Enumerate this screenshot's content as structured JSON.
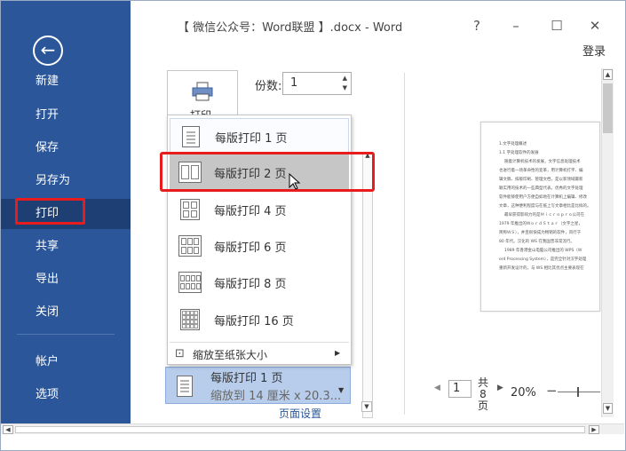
{
  "window": {
    "title": "【 微信公众号：Word联盟 】.docx - Word",
    "help": "?",
    "minimize": "–",
    "maximize": "☐",
    "close": "✕",
    "login": "登录"
  },
  "sidebar": {
    "back": "←",
    "items": [
      "新建",
      "打开",
      "保存",
      "另存为",
      "打印",
      "共享",
      "导出",
      "关闭",
      "帐户",
      "选项"
    ],
    "active": "打印"
  },
  "print": {
    "button_label": "打印",
    "copies_label": "份数:",
    "copies_value": "1",
    "spin_up": "▲",
    "spin_down": "▼"
  },
  "dropdown": {
    "items": [
      "每版打印 1 页",
      "每版打印 2 页",
      "每版打印 4 页",
      "每版打印 6 页",
      "每版打印 8 页",
      "每版打印 16 页"
    ],
    "selected_index": 1,
    "scale_label": "缩放至纸张大小",
    "submenu_arrow": "▶"
  },
  "pages_per_sheet": {
    "title": "每版打印 1 页",
    "subtitle": "缩放到 14 厘米 x 20.3...",
    "arrow": "▼"
  },
  "page_setup": "页面设置",
  "preview": {
    "lines": [
      "1.文字处理概述",
      "1.1 字处理软件的发展",
      "随着计算机技术的发展，文字信息处理技术",
      "也进行着一场革命性的变革，用计算机打字、编",
      "辑文稿、排版印刷、管理文档，是以新领域最新",
      "颖实用的技术的一些典型代表。优秀的文字处理",
      "软件能够使用户方便自如地在计算机上编辑、修改",
      "文章，这种便利程度与在纸上写文章相比是比拟的。",
      "最早获得影响力的是Ｍｉｃｒｏｐｒｏ公司在",
      "1979 年推出的ＷｏｒｄＳｔａｒ（文字之星，",
      "简称ＷＳ），并且很快成为畅销的软件，风行于",
      "80 年代。汉化的 WS 在我国曾非常流行。",
      "1989 年香港金山电脑公司推出的 WPS（Ｗ",
      "ord Processing System），是完全针对汉字处理",
      "重新开发设计的，与 WS 相比其优点主要表现在"
    ]
  },
  "navigation": {
    "prev": "◀",
    "page": "1",
    "total_prefix": "共",
    "total": "8",
    "total_suffix": "页",
    "next": "▶",
    "zoom": "20%",
    "zoom_minus": "−",
    "zoom_level": 0.2
  },
  "scrollbars": {
    "up": "▲",
    "down": "▼",
    "left": "◀",
    "right": "▶"
  },
  "colors": {
    "sidebar": "#2b579a",
    "sidebar_active": "#1e3f73",
    "highlight_red": "#e81c1c",
    "selected_item": "#c6c6c6",
    "pages_selector": "#b7cdeb"
  }
}
